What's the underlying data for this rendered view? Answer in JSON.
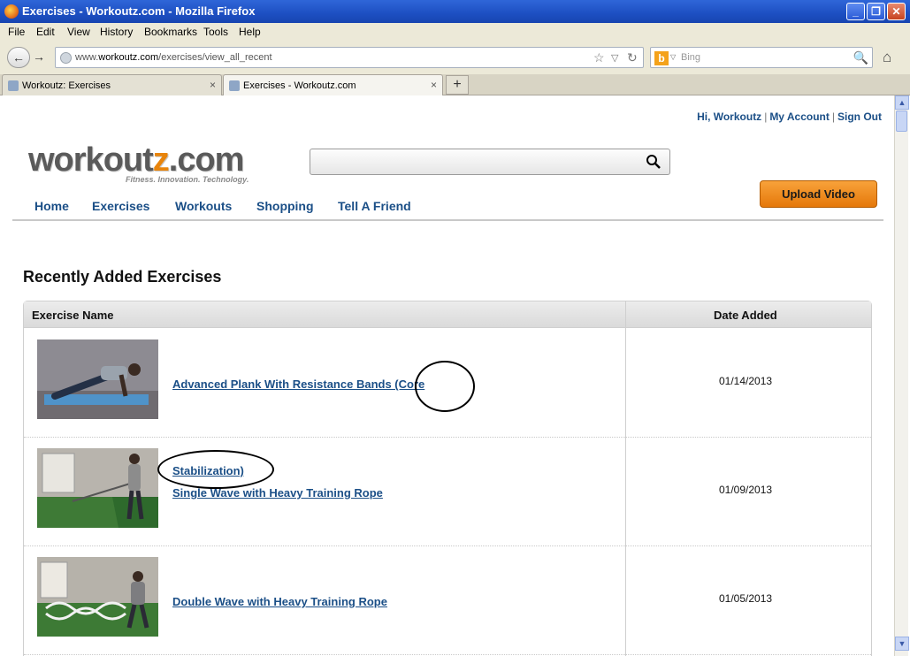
{
  "window": {
    "title": "Exercises - Workoutz.com - Mozilla Firefox",
    "controls": [
      "_",
      "❐",
      "✕"
    ]
  },
  "menu": [
    "File",
    "Edit",
    "View",
    "History",
    "Bookmarks",
    "Tools",
    "Help"
  ],
  "address": {
    "prefix": "www.",
    "domain": "workoutz.com",
    "path": "/exercises/view_all_recent"
  },
  "search_engine": {
    "placeholder": "Bing"
  },
  "tabs": [
    {
      "label": "Workoutz: Exercises",
      "close": "×"
    },
    {
      "label": "Exercises - Workoutz.com",
      "close": "×"
    }
  ],
  "new_tab": "+",
  "site": {
    "user_links": {
      "greeting": "Hi, Workoutz",
      "account": "My Account",
      "signout": "Sign Out",
      "sep": "|"
    },
    "logo": {
      "main": "workout",
      "z": "z",
      "tail": ".com"
    },
    "tagline": "Fitness. Innovation. Technology.",
    "upload_label": "Upload Video",
    "nav": [
      "Home",
      "Exercises",
      "Workouts",
      "Shopping",
      "Tell A Friend"
    ]
  },
  "heading": "Recently Added Exercises",
  "table": {
    "headers": {
      "name": "Exercise Name",
      "date": "Date Added"
    },
    "rows": [
      {
        "line1": "Advanced Plank With Resistance Bands (Core",
        "line2": "",
        "date": "01/14/2013"
      },
      {
        "line1": "Stabilization)",
        "line2": "Single Wave with Heavy Training Rope",
        "date": "01/09/2013"
      },
      {
        "line1": "Double Wave with Heavy Training Rope",
        "line2": "",
        "date": "01/05/2013"
      }
    ]
  },
  "icons": {
    "firefox": "firefox-logo-icon",
    "back": "←",
    "forward": "→",
    "star": "☆",
    "dropdown": "▽",
    "reload": "↻",
    "bing": "b",
    "magnifier": "🔍",
    "home": "⌂",
    "scroll_up": "▲",
    "scroll_down": "▼"
  },
  "colors": {
    "link": "#1b4f87",
    "accent": "#e8840b",
    "titlebar": "#1d4fc2"
  }
}
